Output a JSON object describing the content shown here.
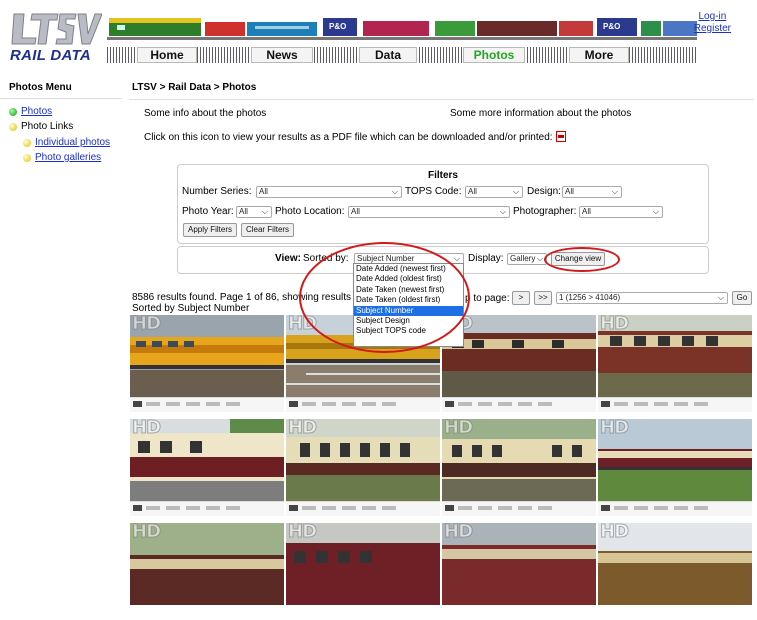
{
  "header": {
    "logo_text": "RAIL DATA",
    "nav": [
      "Home",
      "News",
      "Data",
      "Photos",
      "More"
    ],
    "active_nav": "Photos",
    "login": "Log-in",
    "register": "Register",
    "wagon_logo": "P&O"
  },
  "menu": {
    "title": "Photos Menu",
    "items": [
      "Photos",
      "Photo Links",
      "Individual photos",
      "Photo galleries"
    ]
  },
  "content": {
    "breadcrumb": "LTSV > Rail Data > Photos",
    "info_left": "Some info about the photos",
    "info_right": "Some more information about the photos",
    "pdf_text": "Click on this icon to view your results as a PDF file which can be downloaded and/or printed:"
  },
  "filters": {
    "title": "Filters",
    "number_series_label": "Number Series:",
    "number_series_value": "All",
    "tops_code_label": "TOPS Code:",
    "tops_code_value": "All",
    "design_label": "Design:",
    "design_value": "All",
    "photo_year_label": "Photo Year:",
    "photo_year_value": "All",
    "photo_location_label": "Photo Location:",
    "photo_location_value": "All",
    "photographer_label": "Photographer:",
    "photographer_value": "All",
    "apply_label": "Apply Filters",
    "clear_label": "Clear Filters"
  },
  "view": {
    "view_label": "View:",
    "sorted_by_label": "Sorted by:",
    "sorted_by_value": "Subject Number",
    "display_label": "Display:",
    "display_value": "Gallery",
    "change_view_label": "Change view",
    "sort_options": [
      "Date Added (newest first)",
      "Date Added (oldest first)",
      "Date Taken (newest first)",
      "Date Taken (oldest first)",
      "Subject Number",
      "Subject Design",
      "Subject TOPS code"
    ],
    "selected_option": "Subject Number"
  },
  "results": {
    "summary_left": "8586 results found. Page 1 of 86, sho",
    "summary_mid": "wing results",
    "jump_label": "p to page:",
    "next_label": ">",
    "last_label": ">>",
    "page_select_value": "1 (1256 > 41046)",
    "go_label": "Go",
    "sorted_line": "Sorted by Subject Number"
  },
  "gallery": {
    "hd_badge": "HD"
  },
  "colors": {
    "accent_blue": "#1a30c8",
    "active_green": "#27a327",
    "highlight_red": "#d21a1a",
    "selection_blue": "#1e6fe6"
  }
}
